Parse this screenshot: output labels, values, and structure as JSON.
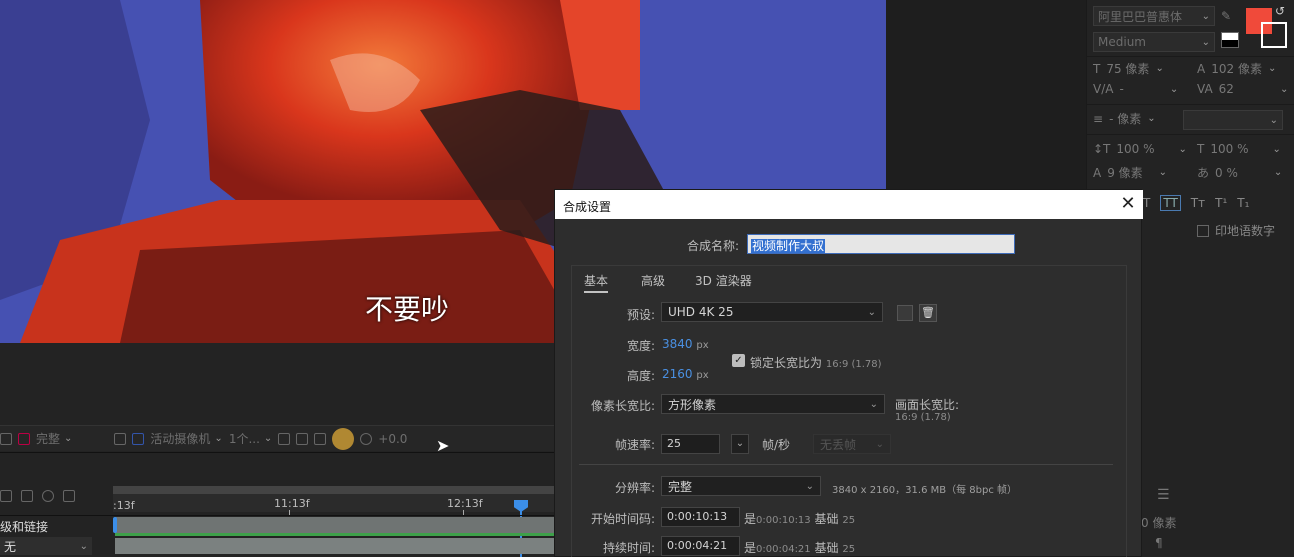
{
  "viewer": {
    "subtitle": "不要吵",
    "toolbar": {
      "resolution": "完整",
      "camera": "活动摄像机",
      "views": "1个...",
      "exposure": "+0.0"
    }
  },
  "timeline": {
    "ticks": [
      ":13f",
      "11:13f",
      "12:13f"
    ],
    "layer_label": "级和链接",
    "parent_value": "无"
  },
  "character_panel": {
    "font_family": "阿里巴巴普惠体",
    "font_style": "Medium",
    "font_size": "75 像素",
    "leading": "102 像素",
    "kerning": "-",
    "tracking": "62",
    "stroke_width": "- 像素",
    "vertical_scale": "100 %",
    "horizontal_scale": "100 %",
    "baseline_shift": "9 像素",
    "tsume": "0 %",
    "hindi_digits": "印地语数字",
    "fill_color": "#f04a3a",
    "indent": "0 像素"
  },
  "dialog": {
    "title": "合成设置",
    "name_label": "合成名称:",
    "name_value": "视频制作大叔",
    "tabs": [
      "基本",
      "高级",
      "3D 渲染器"
    ],
    "preset_label": "预设:",
    "preset_value": "UHD 4K 25",
    "width_label": "宽度:",
    "width_value": "3840",
    "height_label": "高度:",
    "height_value": "2160",
    "px": "px",
    "lock_label": "锁定长宽比为",
    "lock_ratio": "16:9 (1.78)",
    "pixel_aspect_label": "像素长宽比:",
    "pixel_aspect_value": "方形像素",
    "frame_aspect_label": "画面长宽比:",
    "frame_aspect_value": "16:9 (1.78)",
    "frame_rate_label": "帧速率:",
    "frame_rate_value": "25",
    "fps_label": "帧/秒",
    "drop_frame": "无丢帧",
    "resolution_label": "分辨率:",
    "resolution_value": "完整",
    "resolution_info": "3840 x 2160，31.6 MB（每 8bpc 帧）",
    "start_tc_label": "开始时间码:",
    "start_tc_value": "0:00:10:13",
    "start_tc_is": "是",
    "start_tc_eq": "0:00:10:13",
    "base_label": "基础",
    "base_value": "25",
    "duration_label": "持续时间:",
    "duration_value": "0:00:04:21",
    "duration_is": "是",
    "duration_eq": "0:00:04:21"
  }
}
